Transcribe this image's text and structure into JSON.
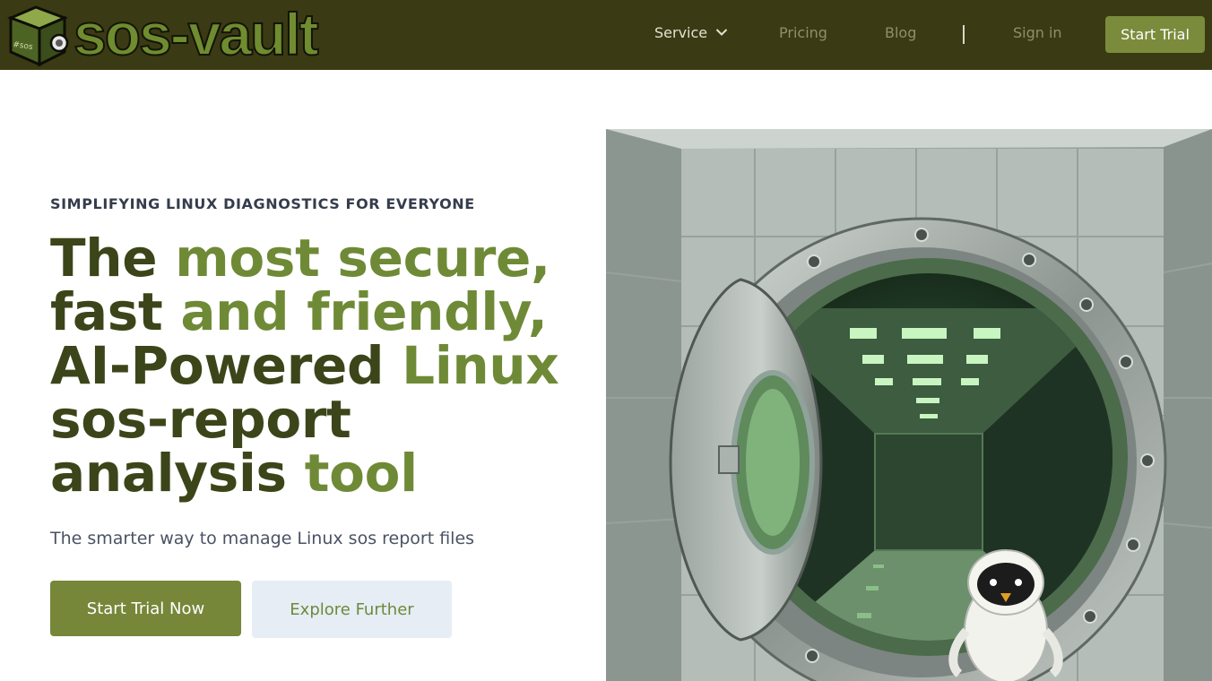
{
  "brand": {
    "name": "sos-vault",
    "logo_cube_text": "#sos",
    "accent": "#7a8c3c",
    "header_bg": "#3a3a14"
  },
  "nav": {
    "service": "Service",
    "pricing": "Pricing",
    "blog": "Blog",
    "sign_in": "Sign in",
    "start_trial": "Start Trial",
    "service_icon": "chevron-down-icon"
  },
  "hero": {
    "eyebrow": "SIMPLIFYING LINUX DIAGNOSTICS FOR EVERYONE",
    "headline": [
      [
        {
          "text": "The ",
          "tone": "dark"
        },
        {
          "text": "most secure,",
          "tone": "light"
        }
      ],
      [
        {
          "text": "fast ",
          "tone": "dark"
        },
        {
          "text": "and friendly,",
          "tone": "light"
        }
      ],
      [
        {
          "text": "AI-Powered ",
          "tone": "dark"
        },
        {
          "text": "Linux",
          "tone": "light"
        }
      ],
      [
        {
          "text": "sos-report",
          "tone": "dark"
        }
      ],
      [
        {
          "text": "analysis ",
          "tone": "dark"
        },
        {
          "text": "tool",
          "tone": "light"
        }
      ]
    ],
    "subtitle": "The smarter way to manage Linux sos report files",
    "primary_button": "Start Trial Now",
    "secondary_button": "Explore Further",
    "image_subject": "open-bank-vault-with-server-room-and-robot-penguin"
  }
}
